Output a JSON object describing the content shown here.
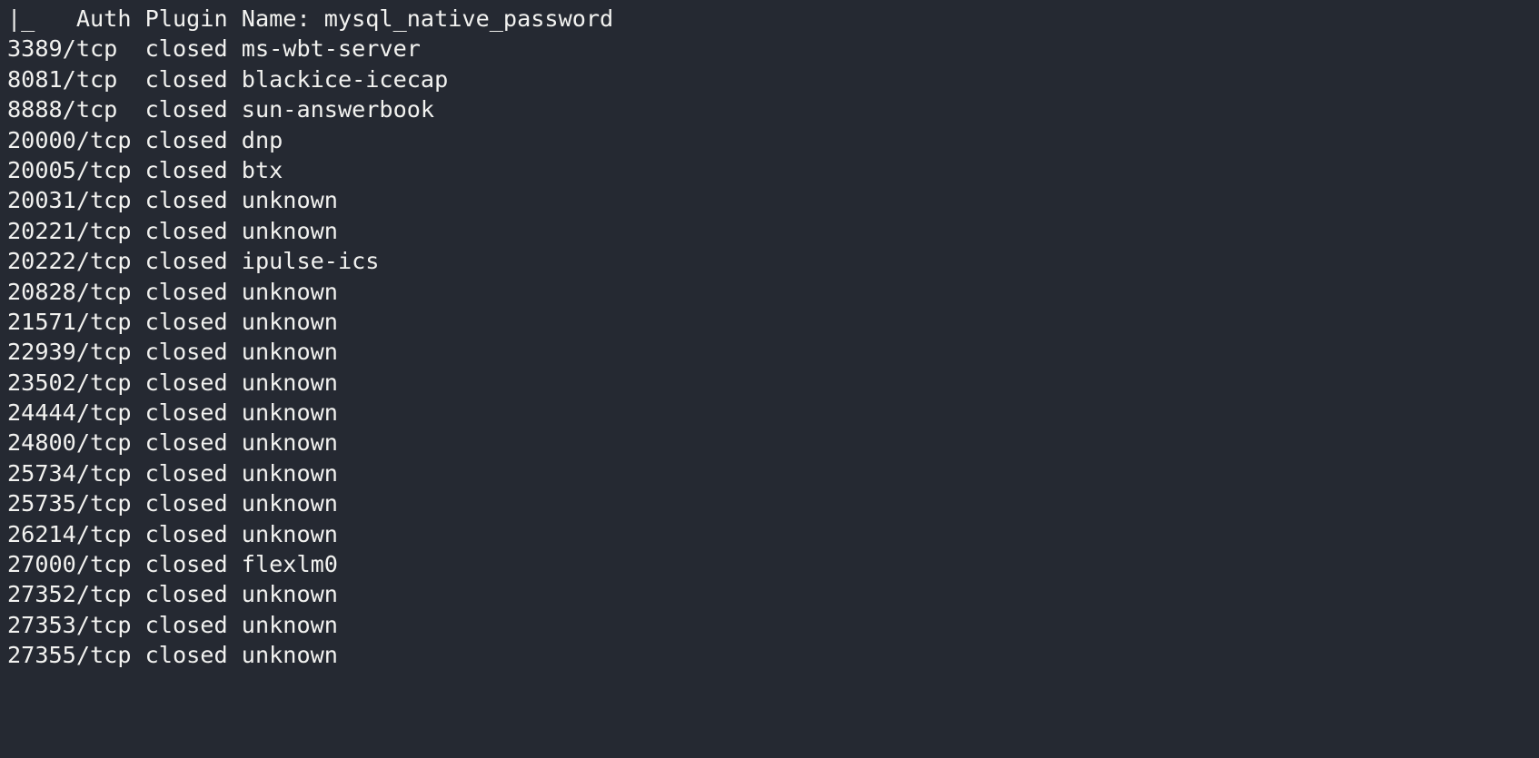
{
  "terminal": {
    "background_color": "#252932",
    "text_color": "#f2f2f0",
    "script_result_line": "|_   Auth Plugin Name: mysql_native_password",
    "column_headers_visible": false,
    "lines": [
      "|_   Auth Plugin Name: mysql_native_password",
      "3389/tcp  closed ms-wbt-server",
      "8081/tcp  closed blackice-icecap",
      "8888/tcp  closed sun-answerbook",
      "20000/tcp closed dnp",
      "20005/tcp closed btx",
      "20031/tcp closed unknown",
      "20221/tcp closed unknown",
      "20222/tcp closed ipulse-ics",
      "20828/tcp closed unknown",
      "21571/tcp closed unknown",
      "22939/tcp closed unknown",
      "23502/tcp closed unknown",
      "24444/tcp closed unknown",
      "24800/tcp closed unknown",
      "25734/tcp closed unknown",
      "25735/tcp closed unknown",
      "26214/tcp closed unknown",
      "27000/tcp closed flexlm0",
      "27352/tcp closed unknown",
      "27353/tcp closed unknown",
      "27355/tcp closed unknown"
    ],
    "port_table": [
      {
        "port": "3389/tcp",
        "state": "closed",
        "service": "ms-wbt-server"
      },
      {
        "port": "8081/tcp",
        "state": "closed",
        "service": "blackice-icecap"
      },
      {
        "port": "8888/tcp",
        "state": "closed",
        "service": "sun-answerbook"
      },
      {
        "port": "20000/tcp",
        "state": "closed",
        "service": "dnp"
      },
      {
        "port": "20005/tcp",
        "state": "closed",
        "service": "btx"
      },
      {
        "port": "20031/tcp",
        "state": "closed",
        "service": "unknown"
      },
      {
        "port": "20221/tcp",
        "state": "closed",
        "service": "unknown"
      },
      {
        "port": "20222/tcp",
        "state": "closed",
        "service": "ipulse-ics"
      },
      {
        "port": "20828/tcp",
        "state": "closed",
        "service": "unknown"
      },
      {
        "port": "21571/tcp",
        "state": "closed",
        "service": "unknown"
      },
      {
        "port": "22939/tcp",
        "state": "closed",
        "service": "unknown"
      },
      {
        "port": "23502/tcp",
        "state": "closed",
        "service": "unknown"
      },
      {
        "port": "24444/tcp",
        "state": "closed",
        "service": "unknown"
      },
      {
        "port": "24800/tcp",
        "state": "closed",
        "service": "unknown"
      },
      {
        "port": "25734/tcp",
        "state": "closed",
        "service": "unknown"
      },
      {
        "port": "25735/tcp",
        "state": "closed",
        "service": "unknown"
      },
      {
        "port": "26214/tcp",
        "state": "closed",
        "service": "unknown"
      },
      {
        "port": "27000/tcp",
        "state": "closed",
        "service": "flexlm0"
      },
      {
        "port": "27352/tcp",
        "state": "closed",
        "service": "unknown"
      },
      {
        "port": "27353/tcp",
        "state": "closed",
        "service": "unknown"
      },
      {
        "port": "27355/tcp",
        "state": "closed",
        "service": "unknown"
      }
    ]
  }
}
